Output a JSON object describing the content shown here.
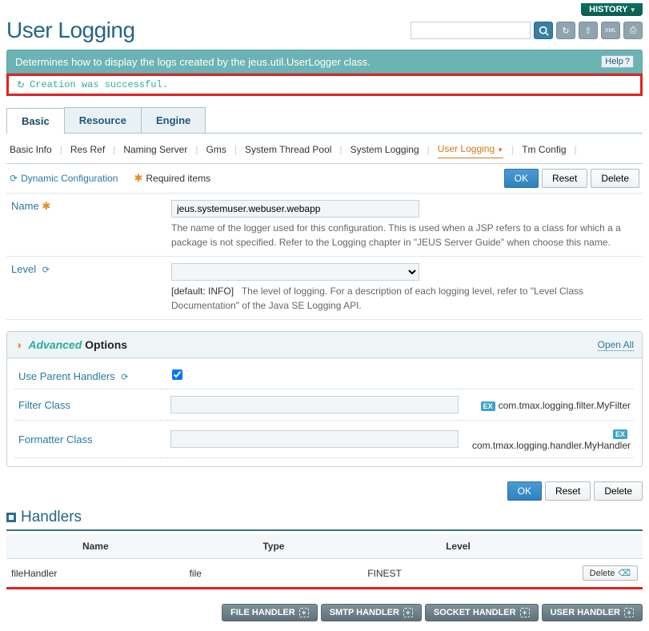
{
  "topbar": {
    "history": "HISTORY"
  },
  "page": {
    "title": "User Logging"
  },
  "search": {
    "placeholder": ""
  },
  "description": "Determines how to display the logs created by the jeus.util.UserLogger class.",
  "help_label": "Help",
  "message": "Creation was successful.",
  "tabs": {
    "basic": "Basic",
    "resource": "Resource",
    "engine": "Engine"
  },
  "subtabs": {
    "basic_info": "Basic Info",
    "res_ref": "Res Ref",
    "naming_server": "Naming Server",
    "gms": "Gms",
    "system_thread_pool": "System Thread Pool",
    "system_logging": "System Logging",
    "user_logging": "User Logging",
    "tm_config": "Tm Config"
  },
  "info": {
    "dynamic": "Dynamic Configuration",
    "required": "Required items"
  },
  "buttons": {
    "ok": "OK",
    "reset": "Reset",
    "delete": "Delete"
  },
  "form": {
    "name_label": "Name",
    "name_value": "jeus.systemuser.webuser.webapp",
    "name_help": "The name of the logger used for this configuration. This is used when a JSP refers to a class for which a a package is not specified. Refer to the Logging chapter in \"JEUS Server Guide\" when choose this name.",
    "level_label": "Level",
    "level_default": "[default: INFO]",
    "level_help": "The level of logging. For a description of each logging level, refer to \"Level Class Documentation\" of the Java SE Logging API."
  },
  "advanced": {
    "title_adv": "Advanced",
    "title_opt": "Options",
    "open_all": "Open All",
    "use_parent": "Use Parent Handlers",
    "filter_class": "Filter Class",
    "filter_example": "com.tmax.logging.filter.MyFilter",
    "formatter_class": "Formatter Class",
    "formatter_example": "com.tmax.logging.handler.MyHandler",
    "ex_label": "EX"
  },
  "handlers": {
    "title": "Handlers",
    "col_name": "Name",
    "col_type": "Type",
    "col_level": "Level",
    "rows": [
      {
        "name": "fileHandler",
        "type": "file",
        "level": "FINEST"
      }
    ],
    "delete_label": "Delete"
  },
  "footer": {
    "file_handler": "FILE HANDLER",
    "smtp_handler": "SMTP HANDLER",
    "socket_handler": "SOCKET HANDLER",
    "user_handler": "USER HANDLER"
  }
}
